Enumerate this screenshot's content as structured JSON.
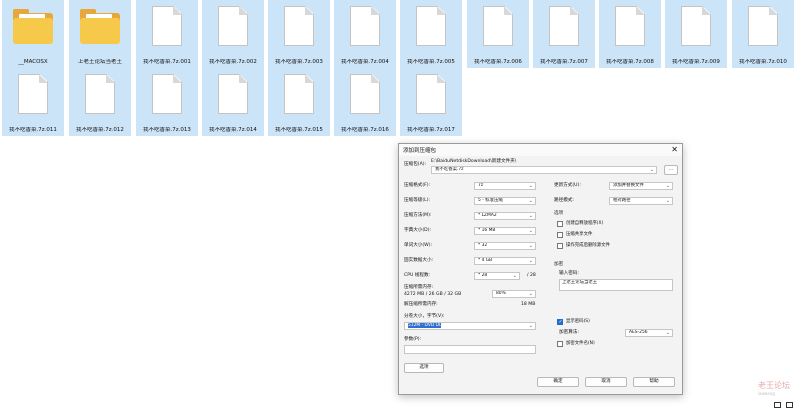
{
  "files": [
    {
      "name": "__MACOSX",
      "type": "folder"
    },
    {
      "name": "上老王论坛当老王",
      "type": "folder"
    },
    {
      "name": "我不吃香菜.7z.001",
      "type": "file"
    },
    {
      "name": "我不吃香菜.7z.002",
      "type": "file"
    },
    {
      "name": "我不吃香菜.7z.003",
      "type": "file"
    },
    {
      "name": "我不吃香菜.7z.004",
      "type": "file"
    },
    {
      "name": "我不吃香菜.7z.005",
      "type": "file"
    },
    {
      "name": "我不吃香菜.7z.006",
      "type": "file"
    },
    {
      "name": "我不吃香菜.7z.007",
      "type": "file"
    },
    {
      "name": "我不吃香菜.7z.008",
      "type": "file"
    },
    {
      "name": "我不吃香菜.7z.009",
      "type": "file"
    },
    {
      "name": "我不吃香菜.7z.010",
      "type": "file"
    },
    {
      "name": "我不吃香菜.7z.011",
      "type": "file"
    },
    {
      "name": "我不吃香菜.7z.012",
      "type": "file"
    },
    {
      "name": "我不吃香菜.7z.013",
      "type": "file"
    },
    {
      "name": "我不吃香菜.7z.014",
      "type": "file"
    },
    {
      "name": "我不吃香菜.7z.015",
      "type": "file"
    },
    {
      "name": "我不吃香菜.7z.016",
      "type": "file"
    },
    {
      "name": "我不吃香菜.7z.017",
      "type": "file"
    }
  ],
  "dialog": {
    "title": "添加到压缩包",
    "close_glyph": "✕",
    "archive_label": "压缩包(A):",
    "archive_path": "E:\\BaiduNetdiskDownload\\新建文件夹\\",
    "archive_name": "我不吃香菜.7z",
    "browse_label": "...",
    "format_label": "压缩格式(F):",
    "format_value": "7z",
    "level_label": "压缩等级(L):",
    "level_value": "5 - 标准压缩",
    "method_label": "压缩方法(M):",
    "method_value": "* LZMA2",
    "dict_label": "字典大小(D):",
    "dict_value": "* 16 MB",
    "word_label": "单词大小(W):",
    "word_value": "* 32",
    "solid_label": "固实数据大小:",
    "solid_value": "* 4 GB",
    "cpu_label": "CPU 线程数:",
    "cpu_value": "* 28",
    "cpu_total": "/ 28",
    "mem_compress_label": "压缩所需内存:",
    "mem_compress_value": "4272 MB / 26 GB / 32 GB",
    "mem_percent": "80%",
    "mem_decompress_label": "解压缩所需内存:",
    "mem_decompress_value": "18 MB",
    "split_label": "分卷大小，字节(V):",
    "split_value": "512M - DVD DL",
    "params_label": "参数(P):",
    "options_button": "选项",
    "update_label": "更新方式(U):",
    "update_value": "添加并替换文件",
    "path_mode_label": "路径模式:",
    "path_mode_value": "相对路径",
    "options_group": "选项",
    "opt_sfx": "创建自释放程序(X)",
    "opt_shared": "压缩共享文件",
    "opt_delete": "操作完成后删除源文件",
    "encrypt_group": "加密",
    "password_label": "输入密码:",
    "password_value": "上老王论坛当老王",
    "show_password": "显示密码(S)",
    "enc_method_label": "加密算法:",
    "enc_method_value": "AES-256",
    "encrypt_names": "加密文件名(N)",
    "ok_button": "确定",
    "cancel_button": "取消",
    "help_button": "帮助"
  },
  "watermark": {
    "text": "老王论坛",
    "sub": "laowang"
  },
  "colors": {
    "selection": "#cce4f7",
    "folder": "#f7c94a",
    "accent": "#1e6ec8"
  }
}
